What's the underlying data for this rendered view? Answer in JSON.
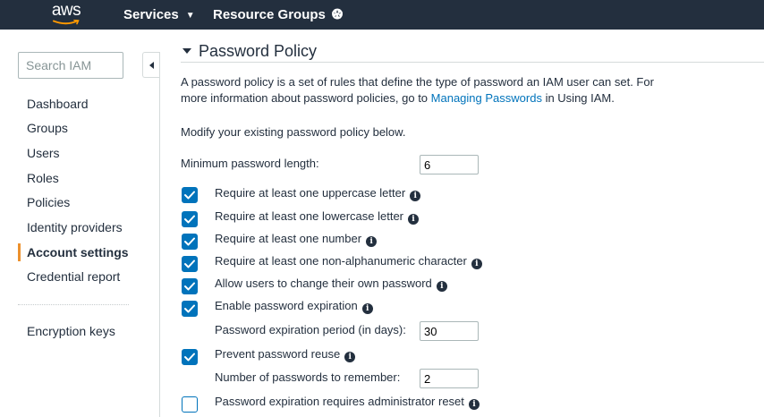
{
  "nav": {
    "logo": "aws",
    "services_label": "Services",
    "resource_groups_label": "Resource Groups",
    "caret": "▼",
    "pin_glyph": "✪"
  },
  "sidebar": {
    "search_placeholder": "Search IAM",
    "items": [
      "Dashboard",
      "Groups",
      "Users",
      "Roles",
      "Policies",
      "Identity providers",
      "Account settings",
      "Credential report"
    ],
    "active_item": "Account settings",
    "secondary_items": [
      "Encryption keys"
    ]
  },
  "main": {
    "section_title": "Password Policy",
    "description_line1": "A password policy is a set of rules that define the type of password an IAM user can set. For",
    "description_line2_before": "more information about password policies, go to ",
    "description_link": "Managing Passwords",
    "description_line2_after": " in Using IAM.",
    "modify_text": "Modify your existing password policy below.",
    "min_length_label": "Minimum password length:",
    "min_length_value": "6",
    "options": [
      {
        "label": "Require at least one uppercase letter",
        "checked": true
      },
      {
        "label": "Require at least one lowercase letter",
        "checked": true
      },
      {
        "label": "Require at least one number",
        "checked": true
      },
      {
        "label": "Require at least one non-alphanumeric character",
        "checked": true
      },
      {
        "label": "Allow users to change their own password",
        "checked": true
      },
      {
        "label": "Enable password expiration",
        "checked": true
      },
      {
        "label": "Prevent password reuse",
        "checked": true
      },
      {
        "label": "Password expiration requires administrator reset",
        "checked": false
      }
    ],
    "expiration_period_label": "Password expiration period (in days):",
    "expiration_period_value": "30",
    "remember_label": "Number of passwords to remember:",
    "remember_value": "2",
    "info_glyph": "i"
  },
  "colors": {
    "nav_bg": "#232f3e",
    "accent_orange": "#ec912d",
    "checkbox_blue": "#0073bb",
    "link_blue": "#0073bb"
  }
}
